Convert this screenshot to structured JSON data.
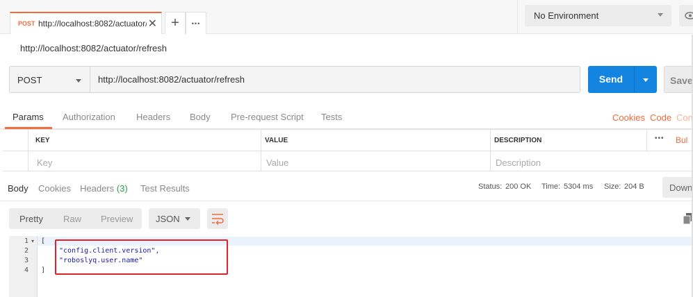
{
  "tab": {
    "method": "POST",
    "url": "http://localhost:8082/actuator/",
    "close": "✕"
  },
  "tab_actions": {
    "add": "+",
    "more": "•••"
  },
  "environment": {
    "selected": "No Environment"
  },
  "request_name": "http://localhost:8082/actuator/refresh",
  "request": {
    "method": "POST",
    "url": "http://localhost:8082/actuator/refresh",
    "send_label": "Send",
    "save_label": "Save"
  },
  "request_tabs": [
    "Params",
    "Authorization",
    "Headers",
    "Body",
    "Pre-request Script",
    "Tests"
  ],
  "request_links": {
    "cookies": "Cookies",
    "code": "Code",
    "comments": "Com"
  },
  "params_table": {
    "headers": {
      "key": "KEY",
      "value": "VALUE",
      "description": "DESCRIPTION"
    },
    "placeholders": {
      "key": "Key",
      "value": "Value",
      "description": "Description"
    },
    "more": "•••",
    "bulk": "Bul"
  },
  "response_tabs": {
    "body": "Body",
    "cookies": "Cookies",
    "headers": "Headers",
    "headers_count": "(3)",
    "test_results": "Test Results"
  },
  "response_status": {
    "status_label": "Status:",
    "status_value": "200 OK",
    "time_label": "Time:",
    "time_value": "5304 ms",
    "size_label": "Size:",
    "size_value": "204 B",
    "download": "Downl"
  },
  "view_modes": [
    "Pretty",
    "Raw",
    "Preview"
  ],
  "format": "JSON",
  "code_lines": [
    {
      "n": "1",
      "text": "["
    },
    {
      "n": "2",
      "text": "\"config.client.version\","
    },
    {
      "n": "3",
      "text": "\"roboslyq.user.name\""
    },
    {
      "n": "4",
      "text": "]"
    }
  ],
  "colors": {
    "accent": "#f26b3a",
    "send": "#1385e0",
    "status_ok": "#2a9d5b",
    "highlight_box": "#e0222a"
  }
}
